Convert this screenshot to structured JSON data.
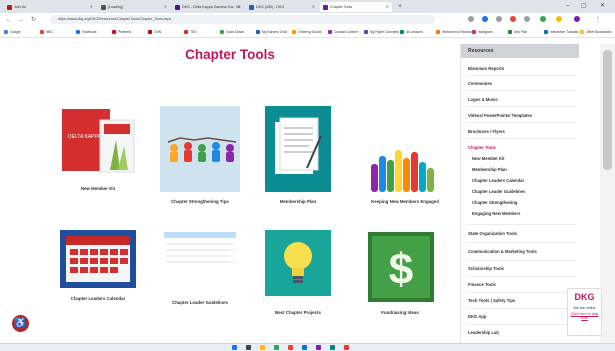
{
  "browser": {
    "tabs": [
      {
        "label": "Join Us",
        "fav": "#b71c1c"
      },
      {
        "label": "[Loading]",
        "fav": "#555"
      },
      {
        "label": "DKG - Delta Kappa Gamma Soc. Int.",
        "fav": "#4a148c"
      },
      {
        "label": "DKG (455) - DKG",
        "fav": "#1565c0"
      },
      {
        "label": "Chapter Tools",
        "fav": "#6a1b9a"
      }
    ],
    "url": "https://www.dkg.org/DKG/Resources/ChapterTools/Chapter_Tools.aspx",
    "bookmarks": [
      "Google",
      "NBC",
      "Facebook",
      "Pinterest",
      "CNN",
      "TED",
      "Good Grade",
      "My Nursery Chat",
      "Ordering Goods",
      "Contact Content",
      "My Paper Concepts",
      "All Lessons",
      "Welcome to Ravena",
      "Instagram",
      "Sep Plan",
      "Interactive Tutorials",
      "Other Bookmarks"
    ]
  },
  "page": {
    "title": "Chapter Tools",
    "tiles": [
      {
        "caption": "New Member Kit"
      },
      {
        "caption": "Chapter Strengthening Tips"
      },
      {
        "caption": "Membership Plan"
      },
      {
        "caption": "Keeping New Members Engaged"
      },
      {
        "caption": "Chapter Leaders Calendar"
      },
      {
        "caption": "Chapter Leader Guidelines"
      },
      {
        "caption": "Best Chapter Projects"
      },
      {
        "caption": "Fundraising Ideas"
      }
    ]
  },
  "sidebar": {
    "header": "Resources",
    "items": [
      "Biennium Reports",
      "Ceremonies",
      "Logos & Music",
      "Videos/ PowerPoints/ Templates",
      "Brochures / Flyers",
      "Chapter Tools",
      "New Member Kit",
      "Membership Plan",
      "Chapter Leaders Calendar",
      "Chapter Leader Guidelines",
      "Chapter Strengthening",
      "Engaging New Members",
      "State Organization Tools",
      "Communication & Marketing Tools",
      "Scholarship Tools",
      "Finance Tools",
      "Tech Tools | Safety Tips",
      "DKG App",
      "Leadership Lab"
    ]
  },
  "widget": {
    "logo": "DKG",
    "line1": "We are online",
    "line2": "Click here to chat now"
  },
  "colors": {
    "accent": "#c2185b",
    "sidebar_head": "#cfd3d7"
  }
}
